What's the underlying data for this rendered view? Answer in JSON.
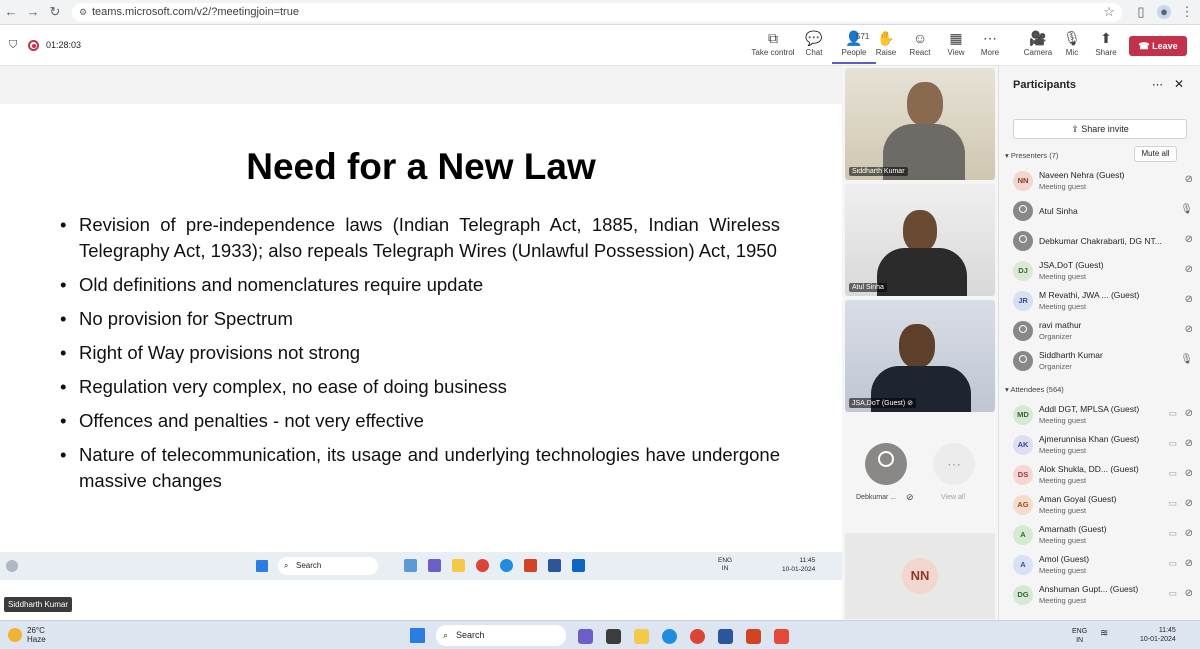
{
  "browser": {
    "url": "teams.microsoft.com/v2/?meetingjoin=true"
  },
  "teams": {
    "timer": "01:28:03",
    "toolbar": [
      {
        "label": "Take control",
        "icon": "take-control-icon",
        "glyph": "⧉"
      },
      {
        "label": "Chat",
        "icon": "chat-icon",
        "glyph": "💬"
      },
      {
        "label": "People",
        "icon": "people-icon",
        "glyph": "👤",
        "count": "571"
      },
      {
        "label": "Raise",
        "icon": "raise-hand-icon",
        "glyph": "✋"
      },
      {
        "label": "React",
        "icon": "react-icon",
        "glyph": "☺"
      },
      {
        "label": "View",
        "icon": "view-icon",
        "glyph": "▦"
      },
      {
        "label": "More",
        "icon": "more-icon",
        "glyph": "⋯"
      },
      {
        "label": "Camera",
        "icon": "camera-icon",
        "glyph": "🎥"
      },
      {
        "label": "Mic",
        "icon": "mic-icon",
        "glyph": "🎙"
      },
      {
        "label": "Share",
        "icon": "share-icon",
        "glyph": "⬆"
      }
    ],
    "leave_label": "Leave"
  },
  "slide": {
    "title": "Need for a New Law",
    "bullets": [
      "Revision of pre-independence laws (Indian Telegraph Act, 1885, Indian Wireless Telegraphy Act, 1933); also repeals Telegraph Wires (Unlawful Possession) Act, 1950",
      "Old definitions and nomenclatures require update",
      "No provision for Spectrum",
      "Right of Way provisions not strong",
      "Regulation very complex, no ease of doing business",
      "Offences and penalties - not very effective",
      "Nature of telecommunication, its usage and underlying technologies have undergone massive changes"
    ]
  },
  "inner_taskbar": {
    "search": "Search",
    "lang": "ENG",
    "region": "IN",
    "time": "11:45",
    "date": "10-01-2024"
  },
  "presenter_name": "Siddharth Kumar",
  "videos": [
    {
      "name": "Siddharth Kumar"
    },
    {
      "name": "Atul Sinha"
    },
    {
      "name": "JSA,DoT (Guest)"
    }
  ],
  "video_extra": {
    "debkumar_label": "Debkumar ...",
    "view_all": "View all",
    "nn_initials": "NN"
  },
  "panel": {
    "title": "Participants",
    "share_invite": "Share invite",
    "presenters_head": "Presenters (7)",
    "mute_all": "Mute all",
    "attendees_head": "Attendees (564)",
    "presenters": [
      {
        "initials": "NN",
        "name": "Naveen Nehra (Guest)",
        "role": "Meeting guest",
        "bg": "#f3d6cf",
        "fg": "#8a3b2a"
      },
      {
        "initials": "",
        "name": "Atul Sinha",
        "role": "",
        "bg": "#8a8886",
        "fg": "#fff"
      },
      {
        "initials": "",
        "name": "Debkumar Chakrabarti, DG NT...",
        "role": "",
        "bg": "#8a8886",
        "fg": "#fff"
      },
      {
        "initials": "DJ",
        "name": "JSA,DoT (Guest)",
        "role": "Meeting guest",
        "bg": "#dbe8d4",
        "fg": "#3b6b2a"
      },
      {
        "initials": "JR",
        "name": "M Revathi, JWA ...   (Guest)",
        "role": "Meeting guest",
        "bg": "#d7dff3",
        "fg": "#3a4f8a"
      },
      {
        "initials": "",
        "name": "ravi mathur",
        "role": "Organizer",
        "bg": "#8a8886",
        "fg": "#fff"
      },
      {
        "initials": "",
        "name": "Siddharth Kumar",
        "role": "Organizer",
        "bg": "#8a8886",
        "fg": "#fff"
      }
    ],
    "attendees": [
      {
        "initials": "MD",
        "name": "Addl DGT, MPLSA (Guest)",
        "role": "Meeting guest",
        "bg": "#d6ead3",
        "fg": "#2f6a2a"
      },
      {
        "initials": "AK",
        "name": "Ajmerunnisa Khan (Guest)",
        "role": "Meeting guest",
        "bg": "#dcdff3",
        "fg": "#3a4688"
      },
      {
        "initials": "DS",
        "name": "Alok Shukla, DD...   (Guest)",
        "role": "Meeting guest",
        "bg": "#f6d5d3",
        "fg": "#9a3a34"
      },
      {
        "initials": "AG",
        "name": "Aman Goyal (Guest)",
        "role": "Meeting guest",
        "bg": "#f6dccd",
        "fg": "#9a4a24"
      },
      {
        "initials": "A",
        "name": "Amarnath (Guest)",
        "role": "Meeting guest",
        "bg": "#d6ead3",
        "fg": "#2f6a2a"
      },
      {
        "initials": "A",
        "name": "Amol (Guest)",
        "role": "Meeting guest",
        "bg": "#d8e2f4",
        "fg": "#3a4f8a"
      },
      {
        "initials": "DG",
        "name": "Anshuman Gupt...   (Guest)",
        "role": "Meeting guest",
        "bg": "#d6ead3",
        "fg": "#2f6a2a"
      }
    ]
  },
  "os_taskbar": {
    "temp": "26°C",
    "weather": "Haze",
    "search": "Search",
    "lang": "ENG",
    "region": "IN",
    "time": "11:45",
    "date": "10-01-2024"
  },
  "colors": {
    "accent": "#5b5fc7",
    "leave": "#c4314b",
    "recording": "#c4314b"
  }
}
